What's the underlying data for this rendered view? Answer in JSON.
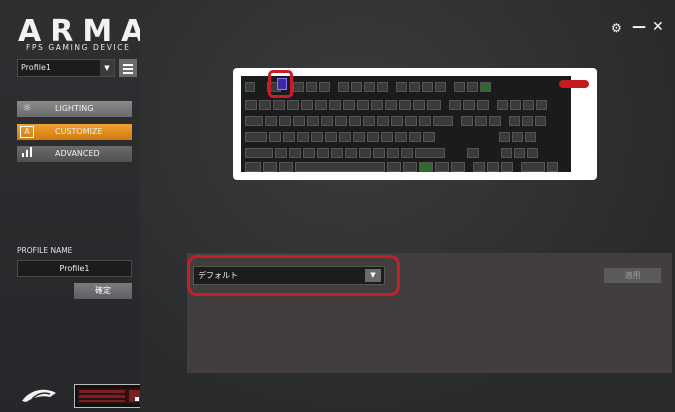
{
  "brand": {
    "logo_text": "ARMA",
    "registered": "®",
    "tagline": "FPS GAMING DEVICE"
  },
  "profile": {
    "selected": "Profile1",
    "arrow": "▼"
  },
  "nav": {
    "items": [
      {
        "label": "LIGHTING",
        "icon": "sun-icon"
      },
      {
        "label": "CUSTOMIZE",
        "icon": "customize-icon"
      },
      {
        "label": "ADVANCED",
        "icon": "bars-icon"
      }
    ],
    "active": "CUSTOMIZE"
  },
  "profile_name": {
    "label": "PROFILE NAME",
    "value": "Profile1",
    "confirm": "確定"
  },
  "window": {
    "settings_icon": "⚙",
    "minimize_icon": "—",
    "close_icon": "✕"
  },
  "customize": {
    "dropdown_value": "デフォルト",
    "dropdown_arrow": "▼",
    "apply": "適用"
  },
  "colors": {
    "accent": "#e08a1e",
    "highlight": "#c52029"
  }
}
